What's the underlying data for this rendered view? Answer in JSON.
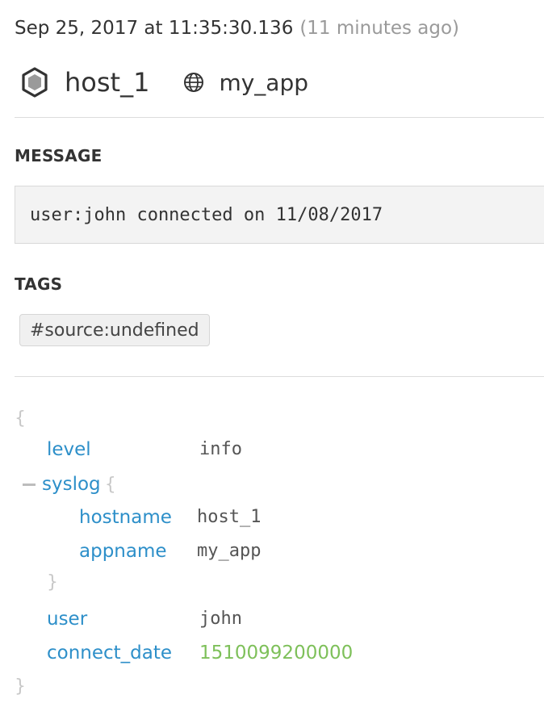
{
  "header": {
    "timestamp": "Sep 25, 2017 at 11:35:30.136",
    "relative_time": "(11 minutes ago)",
    "host": "host_1",
    "service": "my_app",
    "icons": {
      "host": "hexagon-icon",
      "service": "globe-icon"
    }
  },
  "message": {
    "title": "MESSAGE",
    "text": "user:john connected on 11/08/2017"
  },
  "tags": {
    "title": "TAGS",
    "items": [
      "#source:undefined"
    ]
  },
  "attributes": {
    "open_brace": "{",
    "close_brace": "}",
    "level_key": "level",
    "level_value": "info",
    "syslog_key": "syslog",
    "syslog_open": "{",
    "syslog_close": "}",
    "hostname_key": "hostname",
    "hostname_value": "host_1",
    "appname_key": "appname",
    "appname_value": "my_app",
    "user_key": "user",
    "user_value": "john",
    "connect_date_key": "connect_date",
    "connect_date_value": "1510099200000"
  },
  "colors": {
    "key": "#2d8fc9",
    "number_value": "#7ec05a",
    "brace": "#c8c8c8"
  }
}
